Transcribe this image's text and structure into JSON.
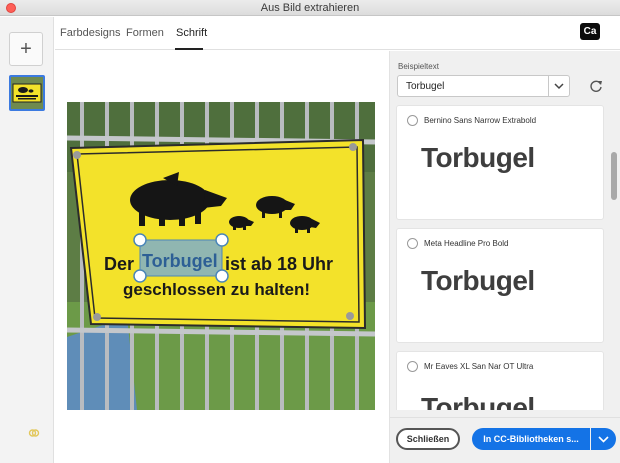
{
  "window": {
    "title": "Aus Bild extrahieren"
  },
  "sidebar": {
    "add_label": "+"
  },
  "tabs": [
    {
      "label": "Farbdesigns"
    },
    {
      "label": "Formen"
    },
    {
      "label": "Schrift",
      "active": true
    }
  ],
  "app_logo": "Ca",
  "image": {
    "sign_line1_before": "Der",
    "sign_selected_word": "Torbugel",
    "sign_line1_after": "ist ab 18 Uhr",
    "sign_line2": "geschlossen zu halten!"
  },
  "panel": {
    "sample_label": "Beispieltext",
    "sample_value": "Torbugel",
    "fonts": [
      {
        "name": "Bernino Sans Narrow Extrabold",
        "sample": "Torbugel"
      },
      {
        "name": "Meta Headline Pro Bold",
        "sample": "Torbugel"
      },
      {
        "name": "Mr Eaves XL San Nar OT Ultra",
        "sample": "Torbugel"
      }
    ]
  },
  "footer": {
    "close_label": "Schließen",
    "primary_label": "In CC-Bibliotheken s..."
  },
  "colors": {
    "accent": "#1473e6",
    "sign_yellow": "#f3e22a",
    "selection": "#7eaec9"
  },
  "icons": [
    "close-window-icon",
    "plus-icon",
    "creative-cloud-icon",
    "chevron-down-icon",
    "refresh-icon",
    "radio-icon"
  ]
}
